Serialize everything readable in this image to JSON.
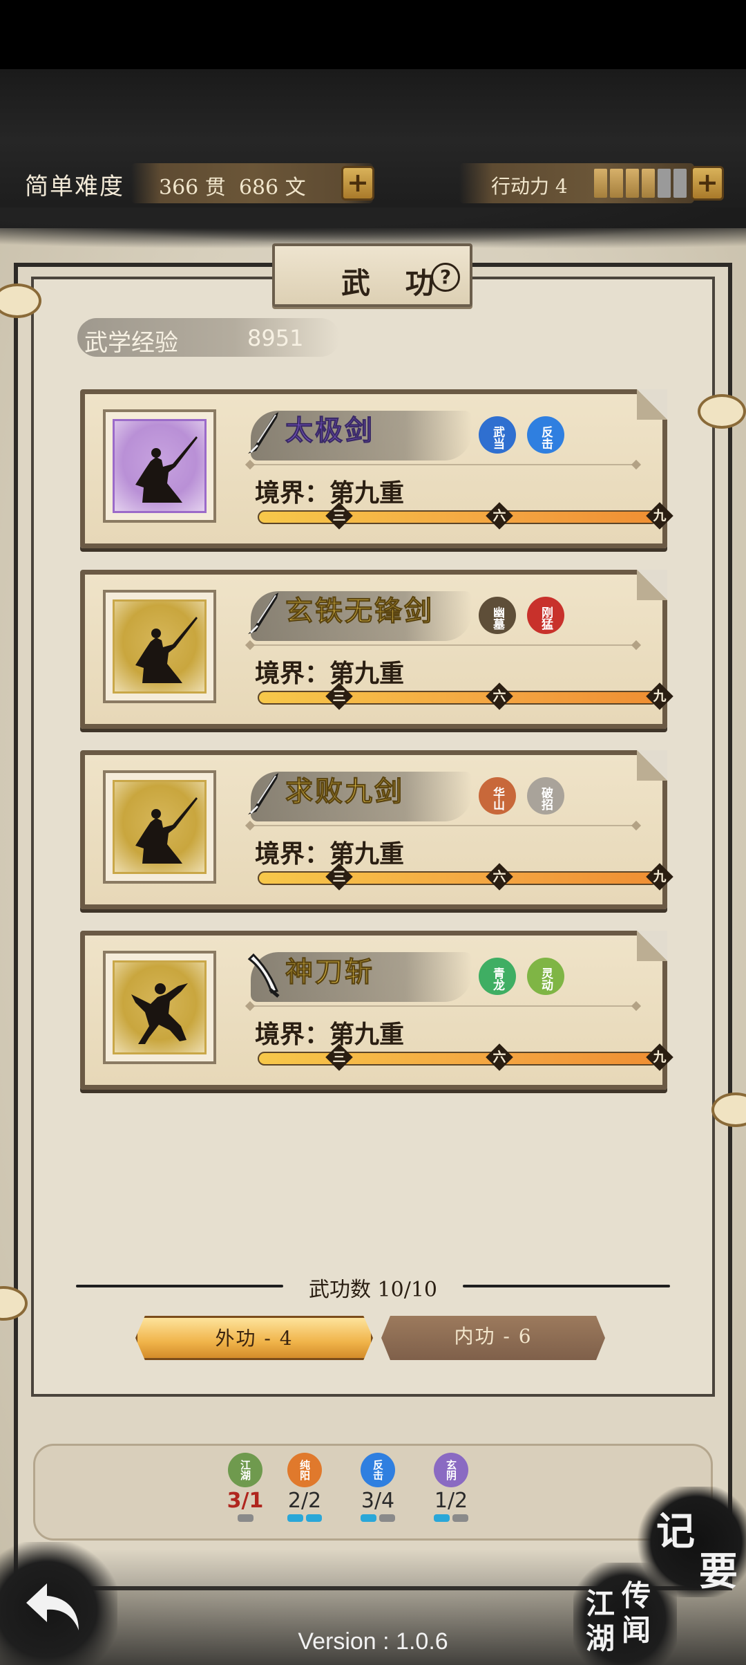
{
  "header": {
    "difficulty": "简单难度",
    "money": "366 贯  686 文",
    "stamina_label": "行动力 4",
    "stamina_current": 4,
    "stamina_max": 6
  },
  "panel": {
    "title": "武 功",
    "exp_label": "武学经验",
    "exp_value": "8951"
  },
  "skills": [
    {
      "name": "太极剑",
      "rarity": "purple",
      "weapon": "sword",
      "badges": [
        {
          "text": "武当",
          "color": "#2f6fd0"
        },
        {
          "text": "反击",
          "color": "#2f7fe0"
        }
      ],
      "realm": "境界：第九重",
      "progress": 1.0
    },
    {
      "name": "玄铁无锋剑",
      "rarity": "gold",
      "weapon": "sword",
      "badges": [
        {
          "text": "幽墓",
          "color": "#5e4e38"
        },
        {
          "text": "刚猛",
          "color": "#c8312b"
        }
      ],
      "realm": "境界：第九重",
      "progress": 1.0
    },
    {
      "name": "求败九剑",
      "rarity": "gold",
      "weapon": "sword",
      "badges": [
        {
          "text": "华山",
          "color": "#c8683a"
        },
        {
          "text": "破招",
          "color": "#a9a39a"
        }
      ],
      "realm": "境界：第九重",
      "progress": 1.0
    },
    {
      "name": "神刀斩",
      "rarity": "gold",
      "weapon": "blade",
      "badges": [
        {
          "text": "青龙",
          "color": "#3fae63"
        },
        {
          "text": "灵动",
          "color": "#7fb545"
        }
      ],
      "realm": "境界：第九重",
      "progress": 1.0
    }
  ],
  "milestones": [
    "三",
    "六",
    "九"
  ],
  "skill_count": "武功数 10/10",
  "tabs": {
    "outer": "外功 - 4",
    "inner": "内功 - 6"
  },
  "factions": [
    {
      "label": "江湖",
      "count": "3/1",
      "alert": true,
      "color": "#6f9a4e",
      "pips": [
        "#8a8a8a"
      ]
    },
    {
      "label": "纯阳",
      "count": "2/2",
      "alert": false,
      "color": "#e0792c",
      "pips": [
        "#2aa7d8",
        "#2aa7d8"
      ]
    },
    {
      "label": "反击",
      "count": "3/4",
      "alert": false,
      "color": "#2f7fe0",
      "pips": [
        "#2aa7d8",
        "#8a8a8a"
      ]
    },
    {
      "label": "玄阴",
      "count": "1/2",
      "alert": false,
      "color": "#8a6ac2",
      "pips": [
        "#2aa7d8",
        "#8a8a8a"
      ]
    }
  ],
  "bottom": {
    "notes_1": "记",
    "notes_2": "要",
    "rumors": [
      "江",
      "湖",
      "传",
      "闻"
    ],
    "version": "Version : 1.0.6"
  }
}
